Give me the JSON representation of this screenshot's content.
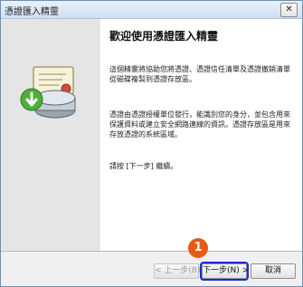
{
  "window": {
    "title": "憑證匯入精靈",
    "close_label": "✕"
  },
  "content": {
    "heading": "歡迎使用憑證匯入精靈",
    "paragraph1": "這個精靈將協助您將憑證、憑證信任清單及憑證撤銷清單從磁碟複製到憑證存放區。",
    "paragraph2": "憑證由憑證授權單位發行，能識別您的身分，並包含用來保護資料或建立安全網路連線的資訊。憑證存放區是用來存放憑證的系統區域。",
    "paragraph3": "請按 [下一步] 繼續。"
  },
  "buttons": {
    "back": "< 上一步(B)",
    "next": "下一步(N) >",
    "cancel": "取消"
  },
  "annotation": {
    "step_number": "1"
  },
  "icons": {
    "wizard": "certificate-import-icon",
    "close": "close-icon"
  },
  "colors": {
    "step_marker": "#ea5a17",
    "focus_outline": "#1d2bd1",
    "left_panel": "#e5e5e5"
  }
}
